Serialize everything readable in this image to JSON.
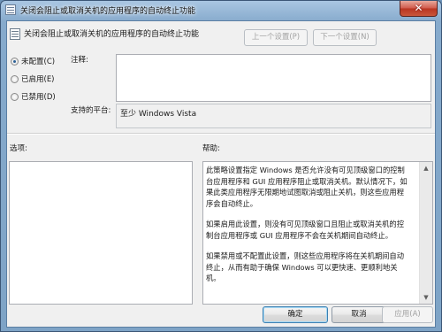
{
  "window": {
    "title": "关闭会阻止或取消关机的应用程序的自动终止功能",
    "close_glyph": "✕"
  },
  "header": {
    "policy_title": "关闭会阻止或取消关机的应用程序的自动终止功能",
    "prev_setting_label": "上一个设置(P)",
    "next_setting_label": "下一个设置(N)"
  },
  "state_options": [
    {
      "label": "未配置(C)",
      "selected": true
    },
    {
      "label": "已启用(E)",
      "selected": false
    },
    {
      "label": "已禁用(D)",
      "selected": false
    }
  ],
  "comment": {
    "label": "注释:",
    "value": ""
  },
  "platform": {
    "label": "支持的平台:",
    "value": "至少 Windows Vista"
  },
  "options": {
    "label": "选项:"
  },
  "help": {
    "label": "帮助:",
    "paragraphs": [
      "此策略设置指定 Windows 是否允许没有可见顶级窗口的控制台应用程序和 GUI 应用程序阻止或取消关机。默认情况下，如果此类应用程序无限期地试图取消或阻止关机，则这些应用程序会自动终止。",
      "如果启用此设置，则没有可见顶级窗口且阻止或取消关机的控制台应用程序或 GUI 应用程序不会在关机期间自动终止。",
      "如果禁用或不配置此设置，则这些应用程序将在关机期间自动终止，从而有助于确保 Windows 可以更快速、更顺利地关机。"
    ]
  },
  "footer": {
    "ok_label": "确定",
    "cancel_label": "取消",
    "apply_label": "应用(A)"
  },
  "icons": {
    "title": "policy-setting-icon",
    "header": "policy-setting-icon",
    "scroll_up": "arrow-up-icon",
    "scroll_down": "arrow-down-icon"
  }
}
